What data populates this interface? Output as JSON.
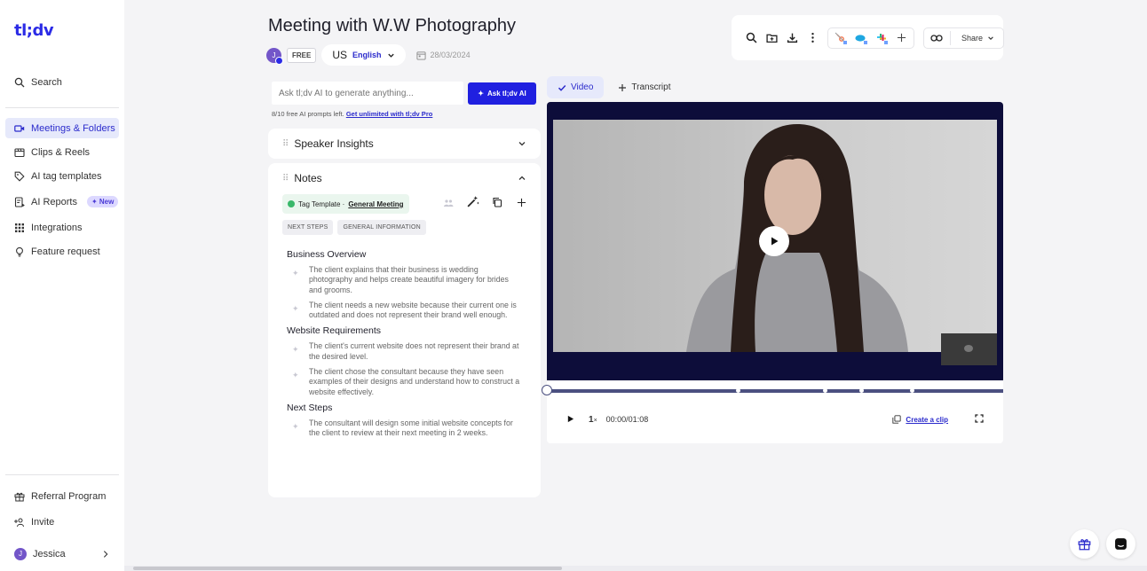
{
  "brand": {
    "logo": "tl;dv",
    "accent": "#2b2be6"
  },
  "sidebar": {
    "search": "Search",
    "items": [
      {
        "label": "Meetings & Folders",
        "icon": "video-camera-icon",
        "active": true
      },
      {
        "label": "Clips & Reels",
        "icon": "clapperboard-icon"
      },
      {
        "label": "AI tag templates",
        "icon": "tag-icon"
      },
      {
        "label": "AI Reports",
        "icon": "report-icon",
        "badge": "New"
      },
      {
        "label": "Integrations",
        "icon": "grid-icon"
      },
      {
        "label": "Feature request",
        "icon": "lightbulb-icon"
      }
    ],
    "referral": "Referral Program",
    "invite": "Invite",
    "user": {
      "name": "Jessica",
      "initial": "J"
    }
  },
  "header": {
    "title": "Meeting with W.W Photography",
    "owner_initial": "J",
    "plan": "FREE",
    "language": {
      "flag": "US",
      "value": "English"
    },
    "date": "28/03/2024",
    "share_label": "Share"
  },
  "ask_ai": {
    "placeholder": "Ask tl;dv AI to generate anything...",
    "button": "Ask tl;dv AI",
    "prompts_left": "8/10 free AI prompts left.",
    "upgrade_link": "Get unlimited with tl;dv Pro"
  },
  "speaker_insights": {
    "title": "Speaker Insights"
  },
  "notes": {
    "title": "Notes",
    "tag_template_prefix": "Tag Template ·",
    "tag_template_name": "General Meeting",
    "chips": [
      "NEXT STEPS",
      "GENERAL INFORMATION"
    ],
    "sections": [
      {
        "heading": "Business Overview",
        "items": [
          "The client explains that their business is wedding photography and helps create beautiful imagery for brides and grooms.",
          "The client needs a new website because their current one is outdated and does not represent their brand well enough."
        ]
      },
      {
        "heading": "Website Requirements",
        "items": [
          "The client's current website does not represent their brand at the desired level.",
          "The client chose the consultant because they have seen examples of their designs and understand how to construct a website effectively."
        ]
      },
      {
        "heading": "Next Steps",
        "items": [
          "The consultant will design some initial website concepts for the client to review at their next meeting in 2 weeks."
        ]
      }
    ]
  },
  "video": {
    "tabs": [
      {
        "label": "Video",
        "active": true
      },
      {
        "label": "Transcript"
      }
    ],
    "speed": "1",
    "speed_unit": "×",
    "time": "00:00/01:08",
    "create_clip": "Create a clip",
    "progress": 0.0,
    "markers": [
      0.42,
      0.61,
      0.69,
      0.8
    ]
  }
}
